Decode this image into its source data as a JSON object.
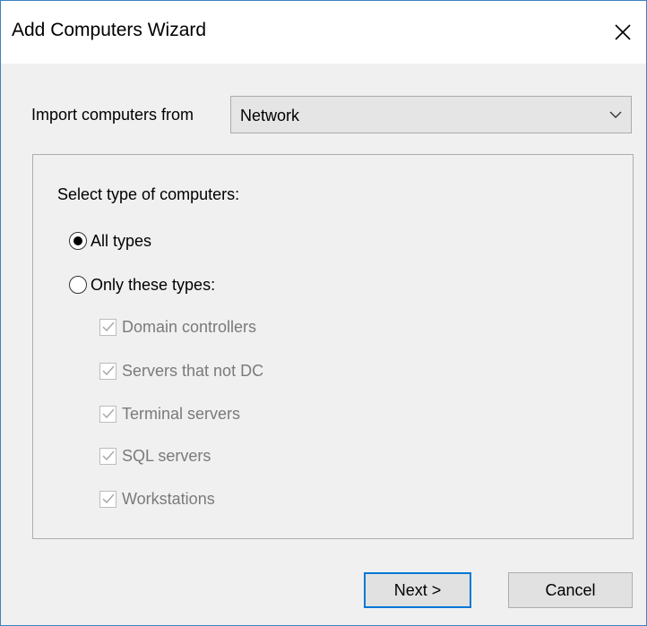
{
  "window": {
    "title": "Add Computers Wizard",
    "close_symbol": "✕"
  },
  "import": {
    "label": "Import computers from",
    "selected": "Network",
    "dropdown_icon": "chevron-down-icon"
  },
  "selection": {
    "group_label": "Select type of computers:",
    "options": [
      {
        "label": "All types",
        "selected": true
      },
      {
        "label": "Only these types:",
        "selected": false
      }
    ],
    "types": [
      {
        "label": "Domain controllers",
        "checked": true,
        "enabled": false
      },
      {
        "label": "Servers that not DC",
        "checked": true,
        "enabled": false
      },
      {
        "label": "Terminal servers",
        "checked": true,
        "enabled": false
      },
      {
        "label": "SQL servers",
        "checked": true,
        "enabled": false
      },
      {
        "label": "Workstations",
        "checked": true,
        "enabled": false
      }
    ]
  },
  "buttons": {
    "next": "Next >",
    "cancel": "Cancel"
  },
  "colors": {
    "window_border": "#3c83c4",
    "default_button_border": "#0078d7",
    "disabled_text": "#7a7a7a"
  }
}
